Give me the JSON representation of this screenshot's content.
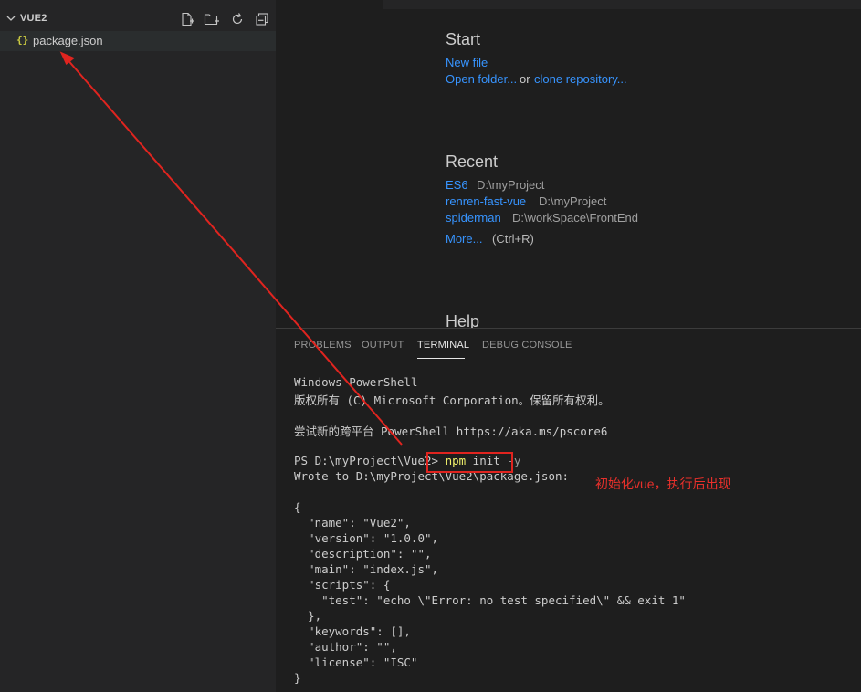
{
  "explorer": {
    "folder_name": "VUE2",
    "toolbar_icons": [
      "new-file-icon",
      "new-folder-icon",
      "refresh-icon",
      "collapse-all-icon"
    ],
    "file": {
      "icon": "{}",
      "name": "package.json"
    }
  },
  "welcome": {
    "start_title": "Start",
    "new_file": "New file",
    "open_folder": "Open folder...",
    "or": "or",
    "clone_repository": "clone repository...",
    "recent_title": "Recent",
    "recent": [
      {
        "name": "ES6",
        "path": "D:\\myProject"
      },
      {
        "name": "renren-fast-vue",
        "path": "D:\\myProject"
      },
      {
        "name": "spiderman",
        "path": "D:\\workSpace\\FrontEnd"
      }
    ],
    "more": "More...",
    "more_shortcut": "(Ctrl+R)",
    "help_title": "Help"
  },
  "panel": {
    "tabs": [
      "PROBLEMS",
      "OUTPUT",
      "TERMINAL",
      "DEBUG CONSOLE"
    ],
    "active_tab": "TERMINAL"
  },
  "terminal": {
    "line1": "Windows PowerShell",
    "line2": "版权所有 (C) Microsoft Corporation。保留所有权利。",
    "line3": "尝试新的跨平台 PowerShell https://aka.ms/pscore6",
    "prompt": "PS D:\\myProject\\Vue2> ",
    "cmd_npm": "npm",
    "cmd_init": " init ",
    "cmd_flag": "-y",
    "wrote": "Wrote to D:\\myProject\\Vue2\\package.json:",
    "json_lines": [
      "{",
      "  \"name\": \"Vue2\",",
      "  \"version\": \"1.0.0\",",
      "  \"description\": \"\",",
      "  \"main\": \"index.js\",",
      "  \"scripts\": {",
      "    \"test\": \"echo \\\"Error: no test specified\\\" && exit 1\"",
      "  },",
      "  \"keywords\": [],",
      "  \"author\": \"\",",
      "  \"license\": \"ISC\"",
      "}"
    ]
  },
  "annotation": {
    "text": "初始化vue，执行后出现",
    "color": "#e8302b"
  },
  "colors": {
    "sidebar_bg": "#252526",
    "editor_bg": "#1e1e1e",
    "link": "#3794ff",
    "annotation_red": "#e0241f"
  }
}
